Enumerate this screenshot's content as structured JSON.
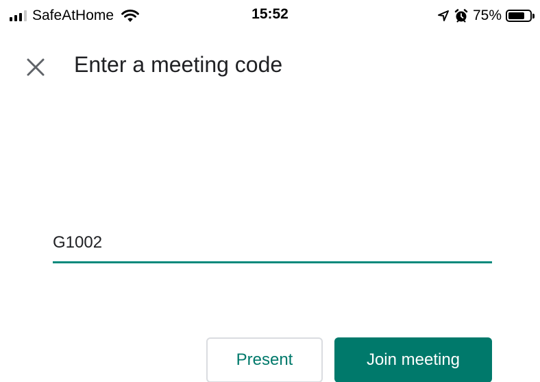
{
  "status_bar": {
    "carrier": "SafeAtHome",
    "time": "15:52",
    "battery_percent": "75%",
    "battery_level": 0.75,
    "icons": [
      "signal-icon",
      "wifi-icon",
      "location-arrow-icon",
      "alarm-clock-icon",
      "battery-icon"
    ]
  },
  "header": {
    "close_icon": "close-icon",
    "title": "Enter a meeting code"
  },
  "form": {
    "meeting_code_value": "G1002"
  },
  "actions": {
    "present_label": "Present",
    "join_label": "Join meeting"
  },
  "colors": {
    "accent": "#00796b",
    "underline": "#00897b",
    "text": "#202124",
    "button_border": "#dadce0"
  }
}
